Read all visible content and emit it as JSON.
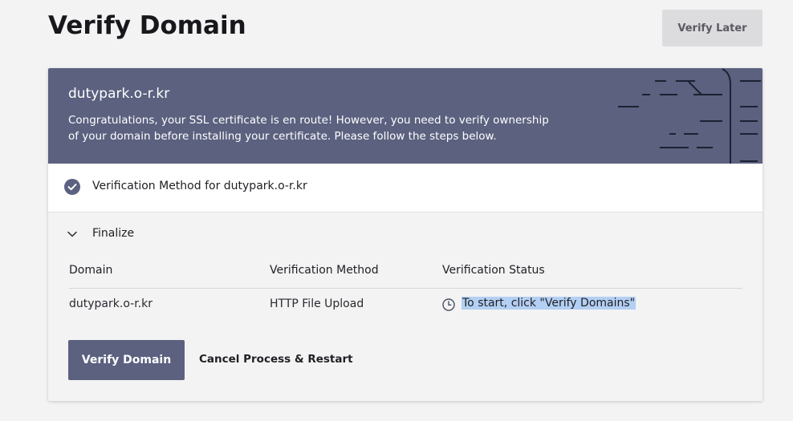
{
  "header": {
    "title": "Verify Domain",
    "verify_later_label": "Verify Later"
  },
  "banner": {
    "domain": "dutypark.o-r.kr",
    "message": "Congratulations, your SSL certificate is en route! However, you need to verify ownership of your domain before installing your certificate. Please follow the steps below.",
    "background_color": "#5b617f"
  },
  "steps": {
    "method_step_label": "Verification Method for dutypark.o-r.kr",
    "method_step_icon": "check-circle-icon",
    "finalize_label": "Finalize",
    "finalize_icon": "chevron-down-icon"
  },
  "table": {
    "columns": [
      "Domain",
      "Verification Method",
      "Verification Status"
    ],
    "rows": [
      {
        "domain": "dutypark.o-r.kr",
        "method": "HTTP File Upload",
        "status_icon": "clock-icon",
        "status": "To start, click \"Verify Domains\""
      }
    ]
  },
  "actions": {
    "verify_domain_label": "Verify Domain",
    "cancel_label": "Cancel Process & Restart"
  },
  "colors": {
    "accent": "#5b617f",
    "selection_highlight": "#b3cff3"
  }
}
